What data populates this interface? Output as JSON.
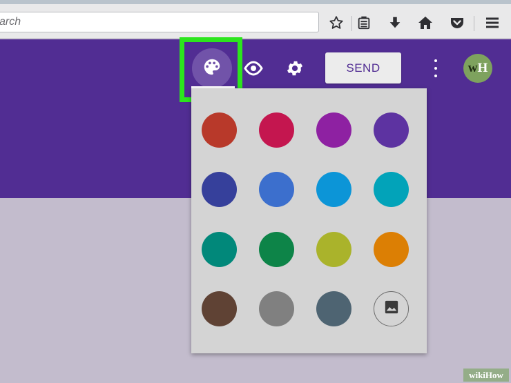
{
  "browser": {
    "search_placeholder": "arch",
    "toolbar_icons": [
      "star-icon",
      "reading-list-icon",
      "download-icon",
      "home-icon",
      "pocket-icon",
      "hamburger-menu-icon"
    ]
  },
  "header": {
    "background": "#512d93",
    "send_label": "SEND",
    "avatar_initials_w": "w",
    "avatar_initials_h": "H",
    "icons": [
      "palette-icon",
      "eye-icon",
      "gear-icon",
      "more-vert-icon"
    ]
  },
  "color_panel": {
    "swatches": [
      {
        "name": "red",
        "color": "#b8392a"
      },
      {
        "name": "crimson",
        "color": "#c4164f"
      },
      {
        "name": "purple",
        "color": "#8e21a2"
      },
      {
        "name": "deep-purple",
        "color": "#5d33a1"
      },
      {
        "name": "indigo",
        "color": "#36409b"
      },
      {
        "name": "blue",
        "color": "#3c6fcd"
      },
      {
        "name": "light-blue",
        "color": "#0c95d7"
      },
      {
        "name": "cyan",
        "color": "#02a3b9"
      },
      {
        "name": "teal",
        "color": "#01887a"
      },
      {
        "name": "green",
        "color": "#0d8448"
      },
      {
        "name": "lime",
        "color": "#aab32b"
      },
      {
        "name": "orange",
        "color": "#dc7f04"
      },
      {
        "name": "brown",
        "color": "#5f4234"
      },
      {
        "name": "grey",
        "color": "#808080"
      },
      {
        "name": "blue-grey",
        "color": "#4e6472"
      },
      {
        "name": "custom-image",
        "color": "",
        "icon": "image-icon"
      }
    ]
  },
  "watermark": "wikiHow"
}
